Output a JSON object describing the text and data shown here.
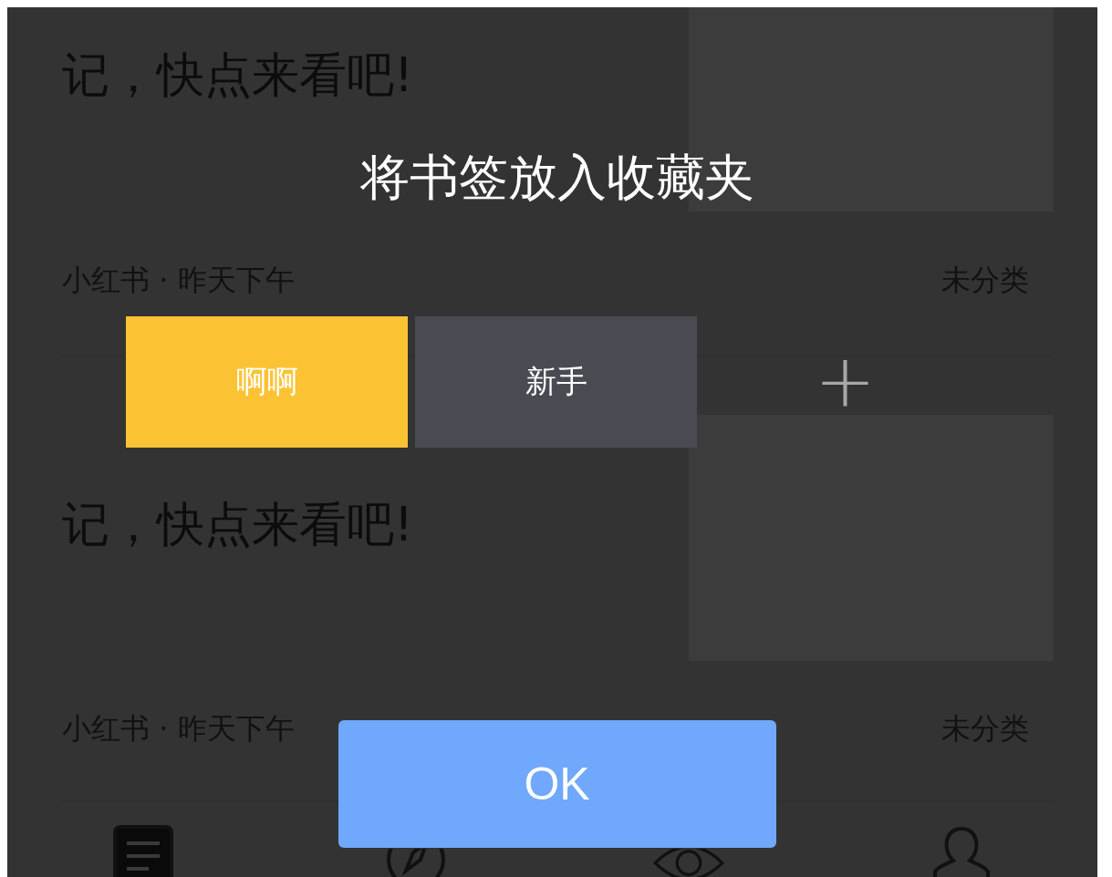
{
  "feed": [
    {
      "text": "记，快点来看吧!",
      "source": "小红书 · 昨天下午",
      "category": "未分类"
    },
    {
      "text": "记，快点来看吧!",
      "source": "小红书 · 昨天下午",
      "category": "未分类"
    }
  ],
  "tab_bar": [
    {
      "kind": "notes",
      "selected": true
    },
    {
      "kind": "discover",
      "selected": false
    },
    {
      "kind": "watch",
      "selected": false
    },
    {
      "kind": "profile",
      "selected": false
    }
  ],
  "dialog": {
    "title": "将书签放入收藏夹",
    "tags": [
      {
        "label": "啊啊",
        "selected": true
      },
      {
        "label": "新手",
        "selected": false
      }
    ],
    "add_button": "+",
    "ok_button": "OK"
  }
}
